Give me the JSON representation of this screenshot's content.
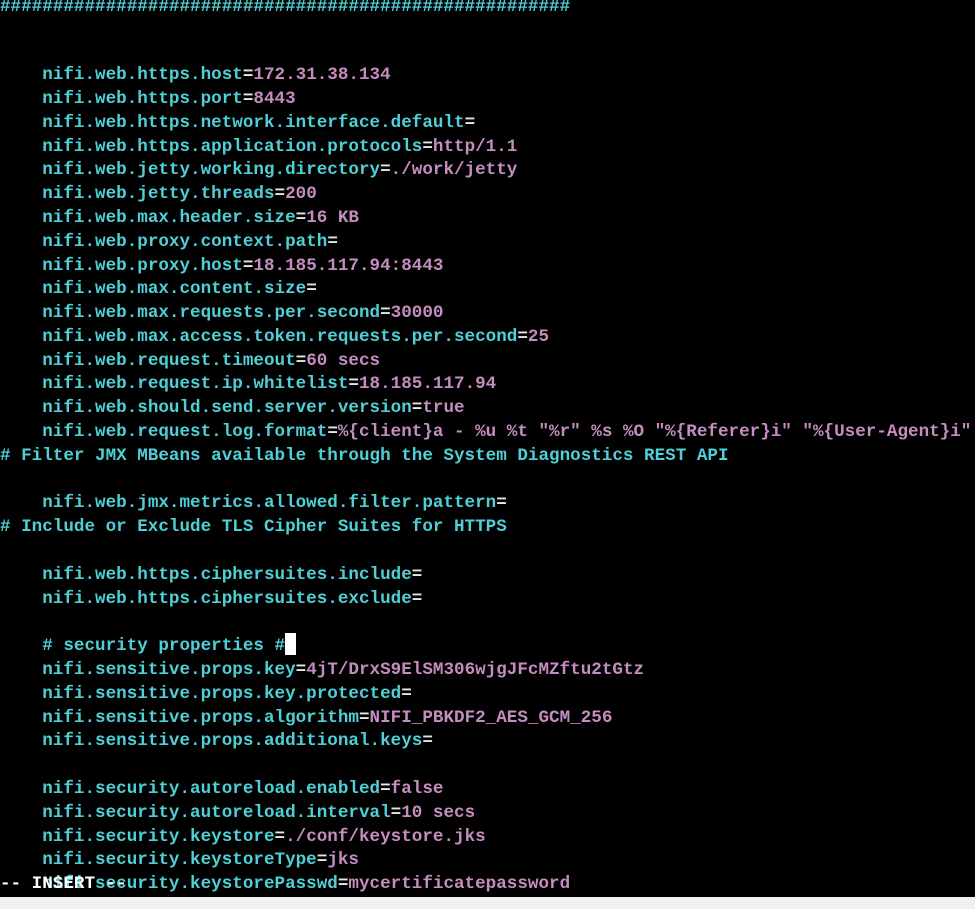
{
  "terminal": {
    "hash_bar": "######################################################",
    "lines": [
      {
        "key": "nifi.web.https.host",
        "val": "172.31.38.134"
      },
      {
        "key": "nifi.web.https.port",
        "val": "8443"
      },
      {
        "key": "nifi.web.https.network.interface.default",
        "val": ""
      },
      {
        "key": "nifi.web.https.application.protocols",
        "val": "http/1.1"
      },
      {
        "key": "nifi.web.jetty.working.directory",
        "val": "./work/jetty"
      },
      {
        "key": "nifi.web.jetty.threads",
        "val": "200"
      },
      {
        "key": "nifi.web.max.header.size",
        "val": "16 KB"
      },
      {
        "key": "nifi.web.proxy.context.path",
        "val": ""
      },
      {
        "key": "nifi.web.proxy.host",
        "val": "18.185.117.94:8443"
      },
      {
        "key": "nifi.web.max.content.size",
        "val": ""
      },
      {
        "key": "nifi.web.max.requests.per.second",
        "val": "30000"
      },
      {
        "key": "nifi.web.max.access.token.requests.per.second",
        "val": "25"
      },
      {
        "key": "nifi.web.request.timeout",
        "val": "60 secs"
      },
      {
        "key": "nifi.web.request.ip.whitelist",
        "val": "18.185.117.94"
      },
      {
        "key": "nifi.web.should.send.server.version",
        "val": "true"
      },
      {
        "key": "nifi.web.request.log.format",
        "val": "%{client}a - %u %t \"%r\" %s %O \"%{Referer}i\" \"%{User-Agent}i\""
      },
      {
        "comment": "# Filter JMX MBeans available through the System Diagnostics REST API"
      },
      {
        "key": "nifi.web.jmx.metrics.allowed.filter.pattern",
        "val": ""
      },
      {
        "comment": "# Include or Exclude TLS Cipher Suites for HTTPS"
      },
      {
        "key": "nifi.web.https.ciphersuites.include",
        "val": ""
      },
      {
        "key": "nifi.web.https.ciphersuites.exclude",
        "val": ""
      },
      {
        "comment": "# security properties #"
      },
      {
        "key": "nifi.sensitive.props.key",
        "val": "4jT/DrxS9ElSM306wjgJFcMZftu2tGtz"
      },
      {
        "key": "nifi.sensitive.props.key.protected",
        "val": ""
      },
      {
        "key": "nifi.sensitive.props.algorithm",
        "val": "NIFI_PBKDF2_AES_GCM_256"
      },
      {
        "key": "nifi.sensitive.props.additional.keys",
        "val": ""
      },
      {
        "key": "nifi.security.autoreload.enabled",
        "val": "false"
      },
      {
        "key": "nifi.security.autoreload.interval",
        "val": "10 secs"
      },
      {
        "key": "nifi.security.keystore",
        "val": "./conf/keystore.jks"
      },
      {
        "key": "nifi.security.keystoreType",
        "val": "jks"
      },
      {
        "key": "nifi.security.keystorePasswd",
        "val": "mycertificatepassword"
      }
    ],
    "equals": "=",
    "status_line": "-- INSERT --"
  },
  "colors": {
    "background": "#000000",
    "key": "#4fd0d6",
    "value": "#c58dbf",
    "equals": "#e6e6e6",
    "comment": "#4fd0d6",
    "status": "#ffffff"
  }
}
